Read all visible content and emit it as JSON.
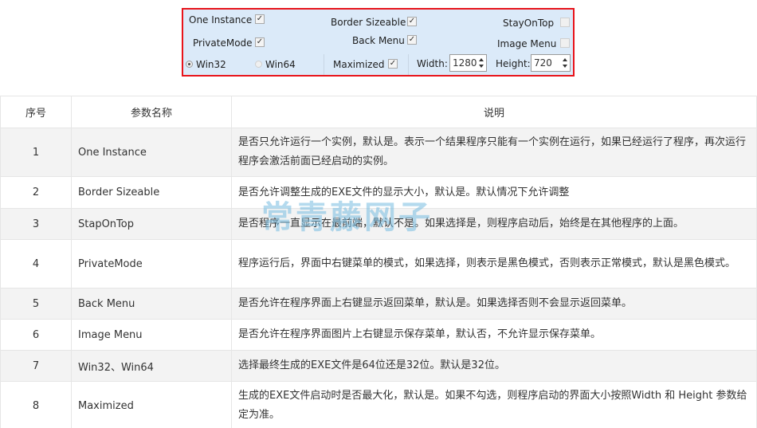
{
  "panel": {
    "one_instance": "One Instance",
    "border_sizeable": "Border Sizeable",
    "stay_on_top": "StayOnTop",
    "private_mode": "PrivateMode",
    "back_menu": "Back Menu",
    "image_menu": "Image Menu",
    "win32": "Win32",
    "win64": "Win64",
    "maximized": "Maximized",
    "width_label": "Width:",
    "width_value": "1280",
    "height_label": "Height:",
    "height_value": "720",
    "check_mark": "✓"
  },
  "table": {
    "headers": {
      "index": "序号",
      "name": "参数名称",
      "desc": "说明"
    },
    "rows": [
      {
        "index": "1",
        "name": "One Instance",
        "desc": "是否只允许运行一个实例，默认是。表示一个结果程序只能有一个实例在运行，如果已经运行了程序，再次运行程序会激活前面已经启动的实例。"
      },
      {
        "index": "2",
        "name": "Border Sizeable",
        "desc": "是否允许调整生成的EXE文件的显示大小，默认是。默认情况下允许调整"
      },
      {
        "index": "3",
        "name": "StapOnTop",
        "desc": "是否程序一直显示在最前端，默认不是。如果选择是，则程序启动后，始终是在其他程序的上面。"
      },
      {
        "index": "4",
        "name": "PrivateMode",
        "desc": "程序运行后，界面中右键菜单的模式，如果选择，则表示是黑色模式，否则表示正常模式，默认是黑色模式。"
      },
      {
        "index": "5",
        "name": "Back Menu",
        "desc": "是否允许在程序界面上右键显示返回菜单，默认是。如果选择否则不会显示返回菜单。"
      },
      {
        "index": "6",
        "name": "Image Menu",
        "desc": "是否允许在程序界面图片上右键显示保存菜单，默认否，不允许显示保存菜单。"
      },
      {
        "index": "7",
        "name": "Win32、Win64",
        "desc": "选择最终生成的EXE文件是64位还是32位。默认是32位。"
      },
      {
        "index": "8",
        "name": "Maximized",
        "desc": "生成的EXE文件启动时是否最大化，默认是。如果不勾选，则程序启动的界面大小按照Width 和 Height 参数给定为准。"
      }
    ]
  },
  "watermark": "常青藤网子"
}
